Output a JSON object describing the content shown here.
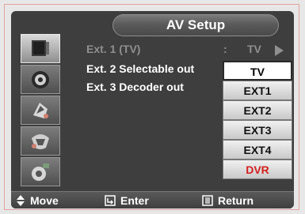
{
  "header": {
    "title": "AV Setup"
  },
  "sidebar": {
    "icons": [
      "picture-icon",
      "sound-icon",
      "channel-icon",
      "setup-icon",
      "input-icon"
    ],
    "active_index": 0
  },
  "menu": {
    "rows": [
      {
        "label": "Ext. 1  (TV)",
        "colon": ":",
        "value": "TV",
        "dimmed": true
      },
      {
        "label": "Ext. 2  Selectable out",
        "colon": ":",
        "dimmed": false
      },
      {
        "label": "Ext. 3  Decoder out",
        "colon": ":",
        "dimmed": false
      }
    ]
  },
  "dropdown": {
    "options": [
      "TV",
      "EXT1",
      "EXT2",
      "EXT3",
      "EXT4",
      "DVR"
    ],
    "selected": "TV"
  },
  "footer": {
    "move": "Move",
    "enter": "Enter",
    "return": "Return"
  },
  "colors": {
    "panel": "#3e3e3e",
    "frame_border": "#e4a2a2",
    "dvr_text": "#d42020"
  }
}
